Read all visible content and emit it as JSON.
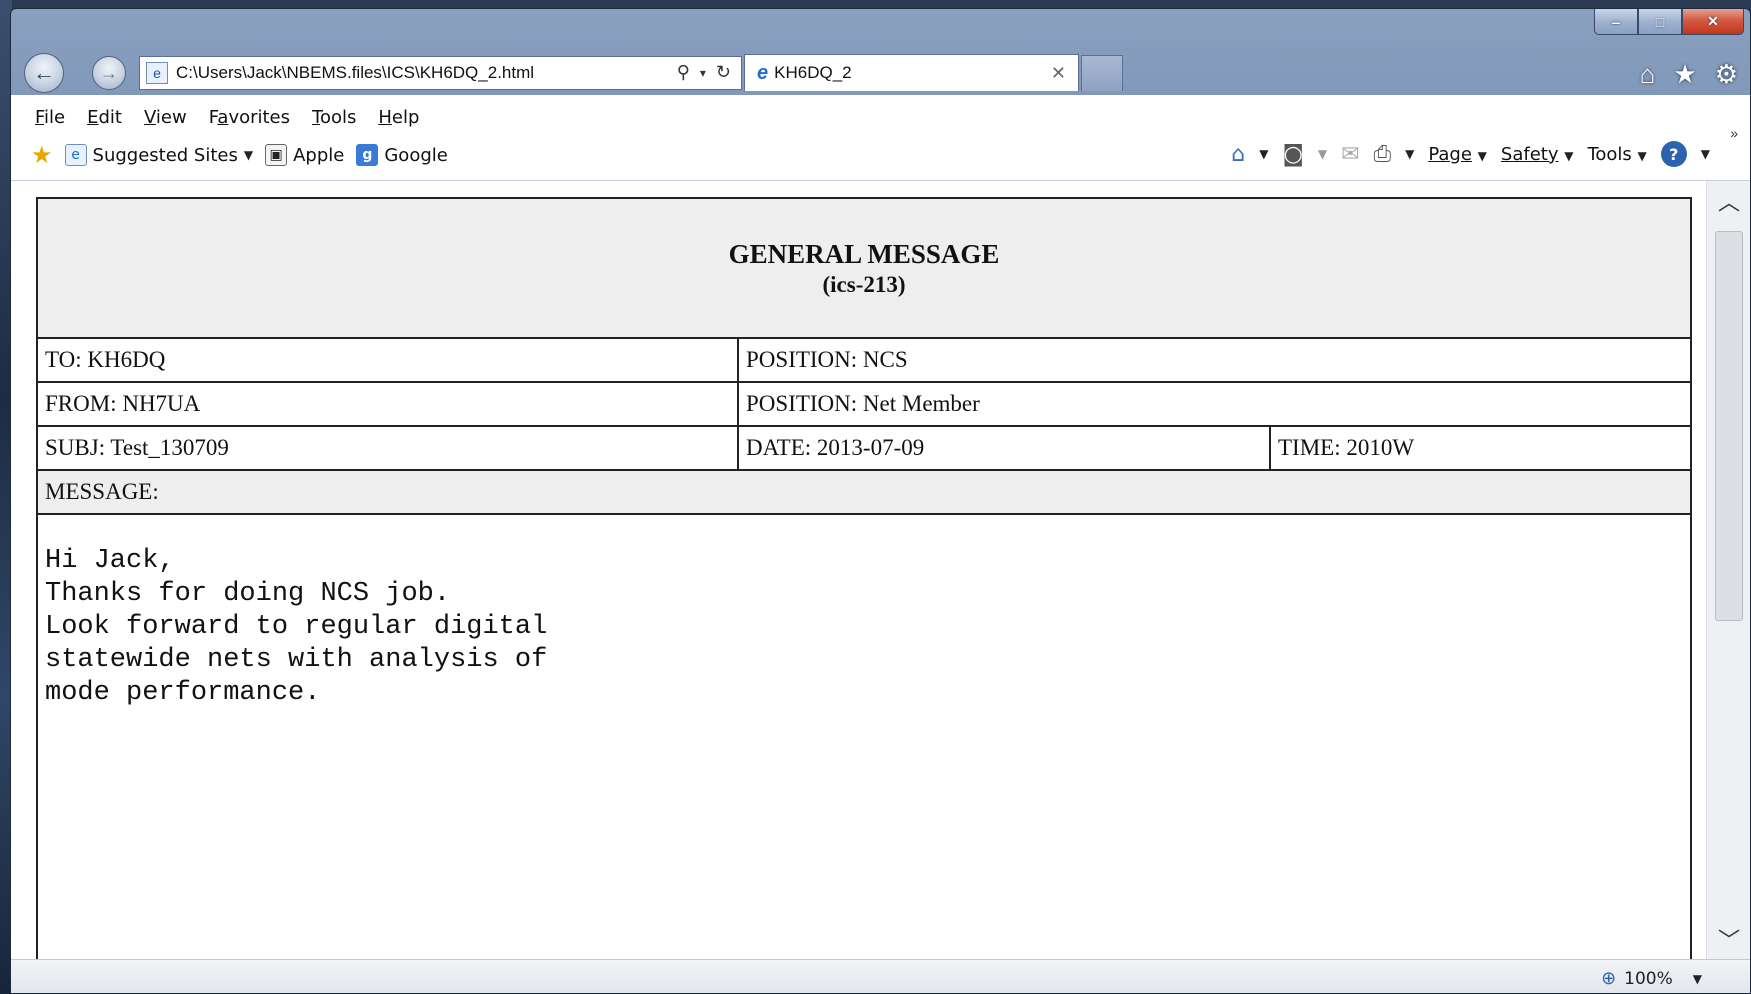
{
  "browser": {
    "address": "C:\\Users\\Jack\\NBEMS.files\\ICS\\KH6DQ_2.html",
    "tab_title": "KH6DQ_2",
    "caption": {
      "minimize": "‒",
      "maximize": "□",
      "close": "✕"
    },
    "menu": [
      {
        "accel": "F",
        "rest": "ile"
      },
      {
        "accel": "E",
        "rest": "dit"
      },
      {
        "accel": "V",
        "rest": "iew"
      },
      {
        "prefix": "F",
        "accel": "a",
        "rest": "vorites"
      },
      {
        "accel": "T",
        "rest": "ools"
      },
      {
        "accel": "H",
        "rest": "elp"
      }
    ],
    "favorites": {
      "suggested": "Suggested Sites",
      "apple": "Apple",
      "google": "Google"
    },
    "commands": {
      "page": "Page",
      "safety": "Safety",
      "tools": "Tools"
    },
    "zoom": "100%"
  },
  "form": {
    "title": "GENERAL MESSAGE",
    "subtitle": "(ics-213)",
    "to": "TO: KH6DQ",
    "to_position": "POSITION: NCS",
    "from": "FROM: NH7UA",
    "from_position": "POSITION: Net Member",
    "subject": "SUBJ: Test_130709",
    "date": "DATE: 2013-07-09",
    "time": "TIME: 2010W",
    "message_label": "MESSAGE:",
    "message_body": "Hi Jack,\nThanks for doing NCS job.\nLook forward to regular digital\nstatewide nets with analysis of\nmode performance."
  }
}
